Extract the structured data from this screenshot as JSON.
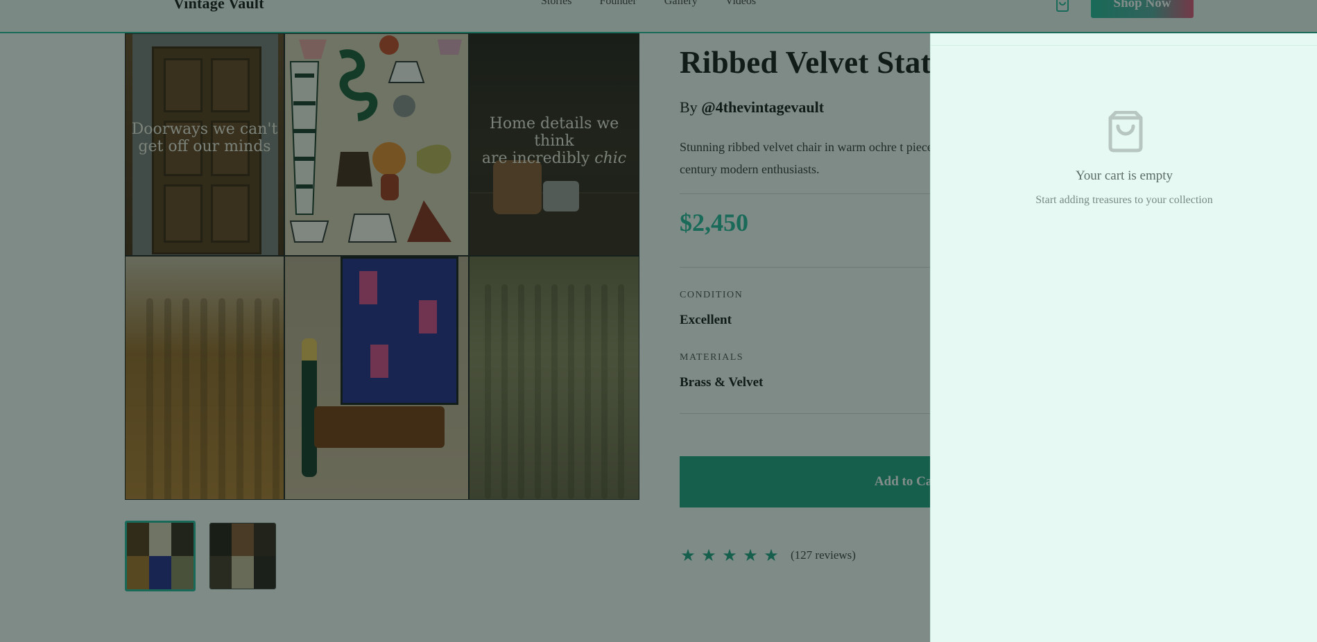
{
  "header": {
    "logo": "Vintage Vault",
    "nav": [
      "Stories",
      "Founder",
      "Gallery",
      "Videos"
    ],
    "shop_now": "Shop Now",
    "cart_icon": "shopping-bag-icon"
  },
  "gallery": {
    "overlay_1": "Doorways we can't get off our minds",
    "overlay_3_line1": "Home details we think",
    "overlay_3_line2": "are incredibly",
    "overlay_3_italic": "chic"
  },
  "product": {
    "title": "Ribbed Velvet Stat",
    "by_prefix": "By",
    "handle": "@4thevintagevault",
    "description": "Stunning ribbed velvet chair in warm ochre t piece for mid-century modern enthusiasts.",
    "price": "$2,450",
    "condition_label": "CONDITION",
    "condition_value": "Excellent",
    "materials_label": "MATERIALS",
    "materials_value": "Brass & Velvet",
    "add_to_cart": "Add to Cart",
    "rating": 5,
    "reviews": "(127 reviews)"
  },
  "cart": {
    "empty_title": "Your cart is empty",
    "empty_subtitle": "Start adding treasures to your collection",
    "icon": "shopping-bag-icon"
  },
  "colors": {
    "accent": "#2bb89a",
    "accent_dark": "#22a383",
    "drawer_bg": "#e6f9f3",
    "brand_pink": "#e0557a"
  }
}
